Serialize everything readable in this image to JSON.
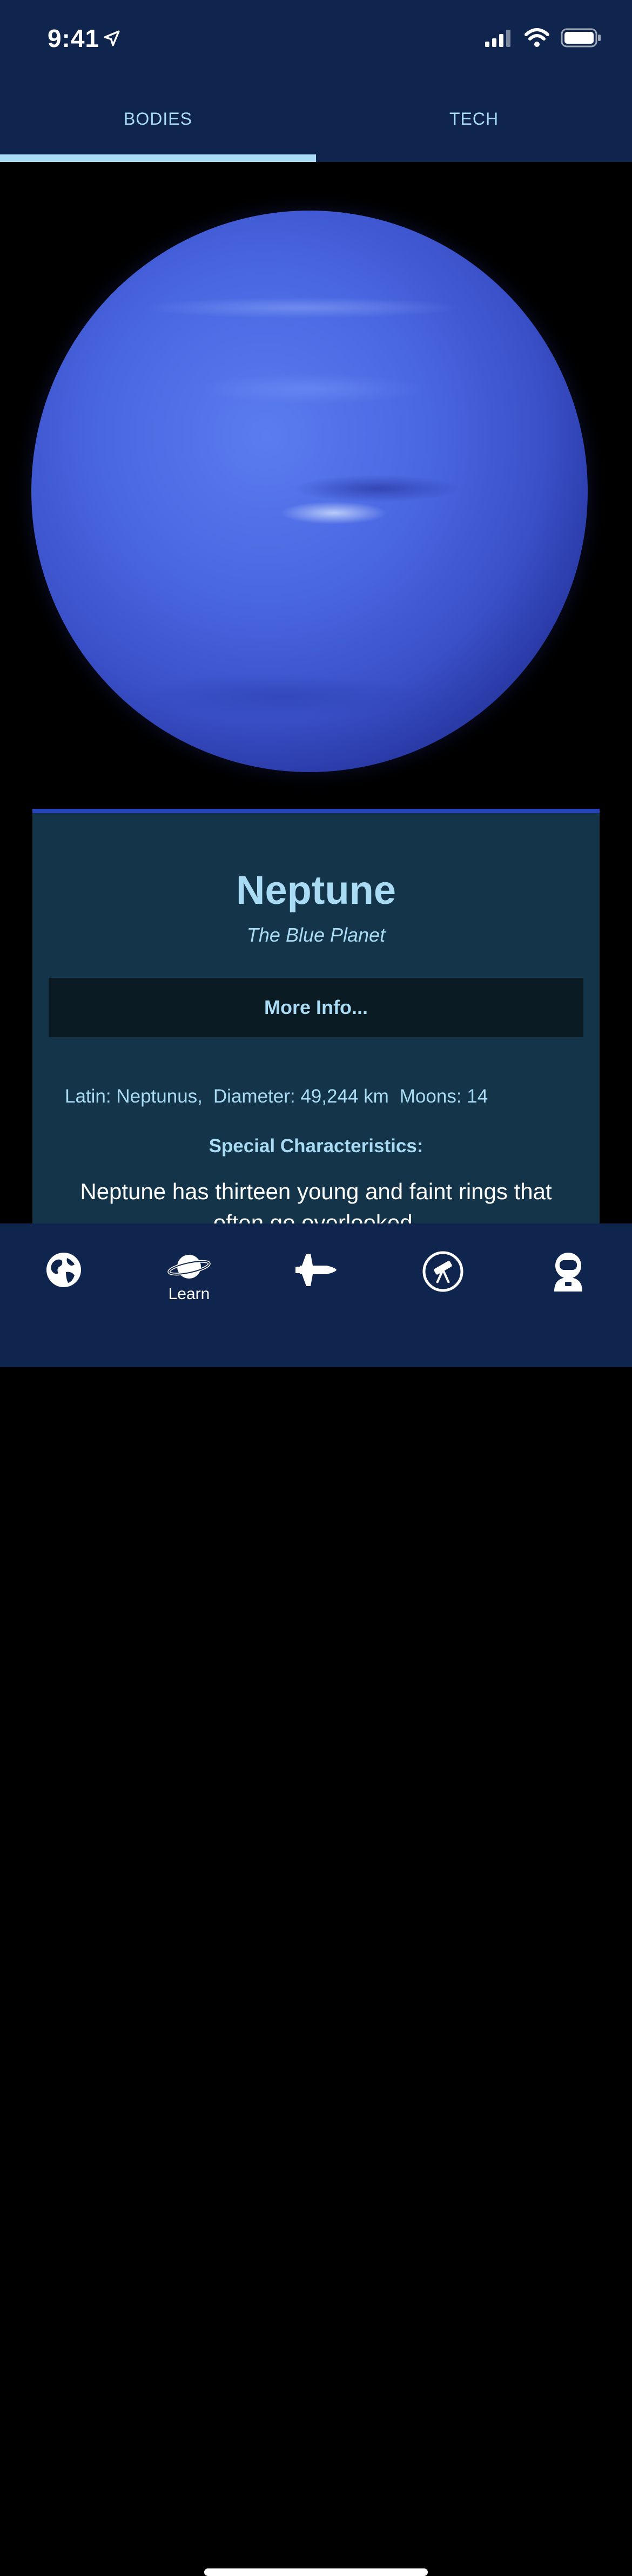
{
  "status_bar": {
    "time": "9:41"
  },
  "top_tabs": [
    {
      "label": "BODIES",
      "active": true
    },
    {
      "label": "TECH",
      "active": false
    }
  ],
  "planet": {
    "name": "Neptune",
    "subtitle": "The Blue Planet",
    "more_info_label": "More Info...",
    "facts": {
      "latin": "Latin: Neptunus,",
      "diameter": "Diameter: 49,244 km",
      "moons": "Moons: 14"
    },
    "special_title": "Special Characteristics:",
    "special_text": "Neptune has thirteen young and faint rings that often go overlooked."
  },
  "bottom_tabs": [
    {
      "icon": "globe-icon",
      "label": ""
    },
    {
      "icon": "planet-icon",
      "label": "Learn"
    },
    {
      "icon": "shuttle-icon",
      "label": ""
    },
    {
      "icon": "telescope-icon",
      "label": ""
    },
    {
      "icon": "astronaut-icon",
      "label": ""
    }
  ],
  "colors": {
    "header_bg": "#10254d",
    "accent": "#a9dcf4",
    "card_bg": "#143449",
    "card_border": "#2444b8"
  }
}
